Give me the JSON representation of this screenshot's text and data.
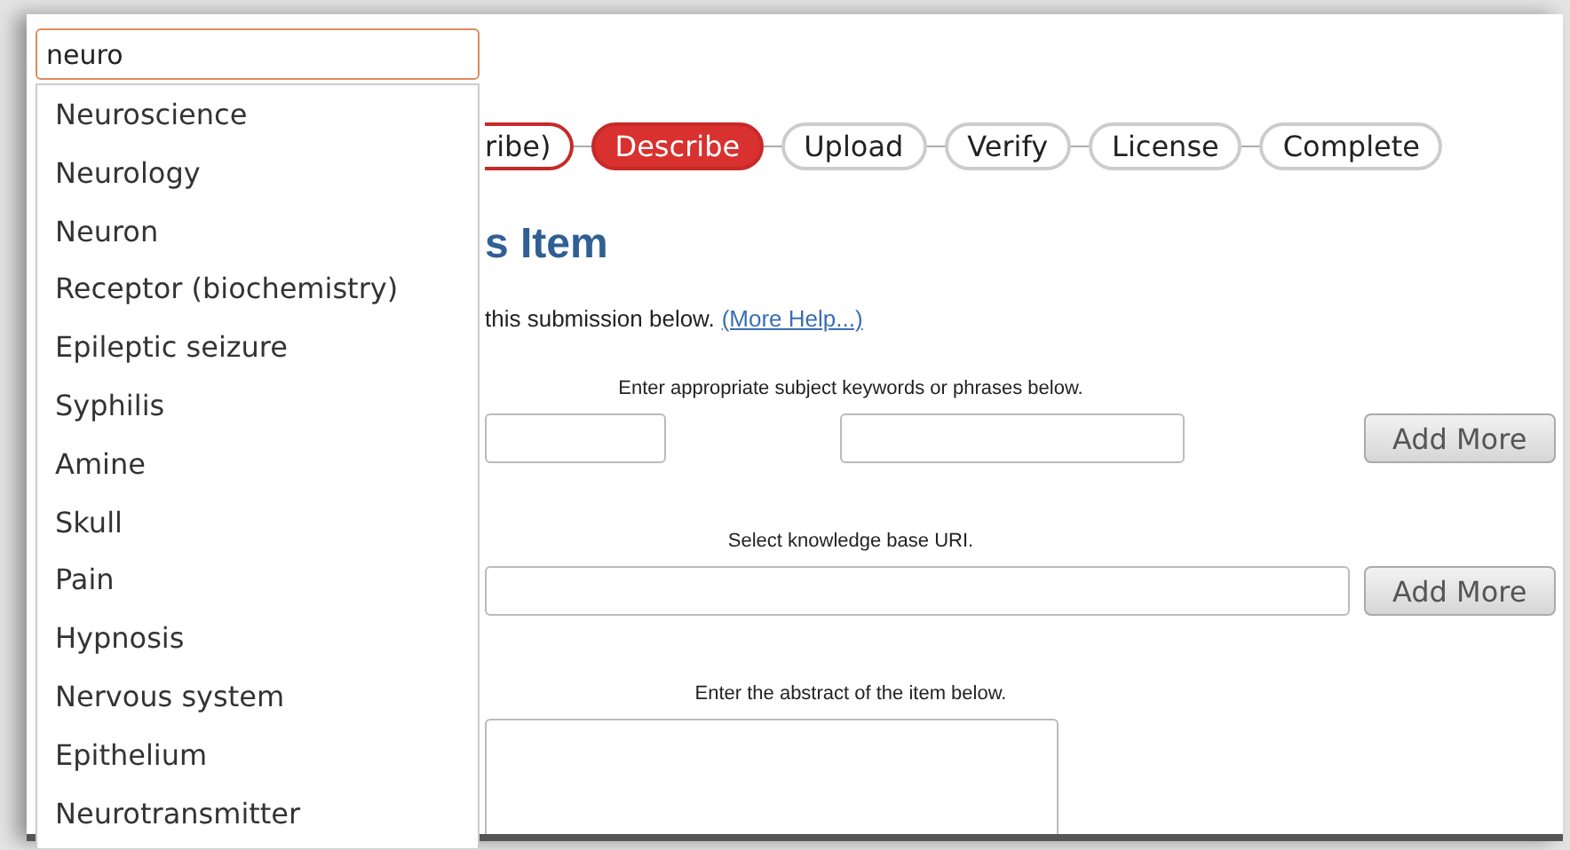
{
  "search": {
    "value": "neuro"
  },
  "suggestions": [
    "Neuroscience",
    "Neurology",
    "Neuron",
    "Receptor (biochemistry)",
    "Epileptic seizure",
    "Syphilis",
    "Amine",
    "Skull",
    "Pain",
    "Hypnosis",
    "Nervous system",
    "Epithelium",
    "Neurotransmitter"
  ],
  "steps": [
    {
      "label": "ribe)",
      "selected": false
    },
    {
      "label": "Describe",
      "selected": true
    },
    {
      "label": "Upload",
      "selected": false
    },
    {
      "label": "Verify",
      "selected": false
    },
    {
      "label": "License",
      "selected": false
    },
    {
      "label": "Complete",
      "selected": false
    }
  ],
  "heading": "s Item",
  "intro": {
    "text": "this submission below.",
    "link": "(More Help...)"
  },
  "fields": [
    {
      "kind": "pair",
      "label": "Enter appropriate subject keywords or phrases below.",
      "button": "Add More"
    },
    {
      "kind": "single",
      "label": "Select knowledge base URI.",
      "button": "Add More"
    },
    {
      "kind": "textarea",
      "label": "Enter the abstract of the item below."
    }
  ]
}
